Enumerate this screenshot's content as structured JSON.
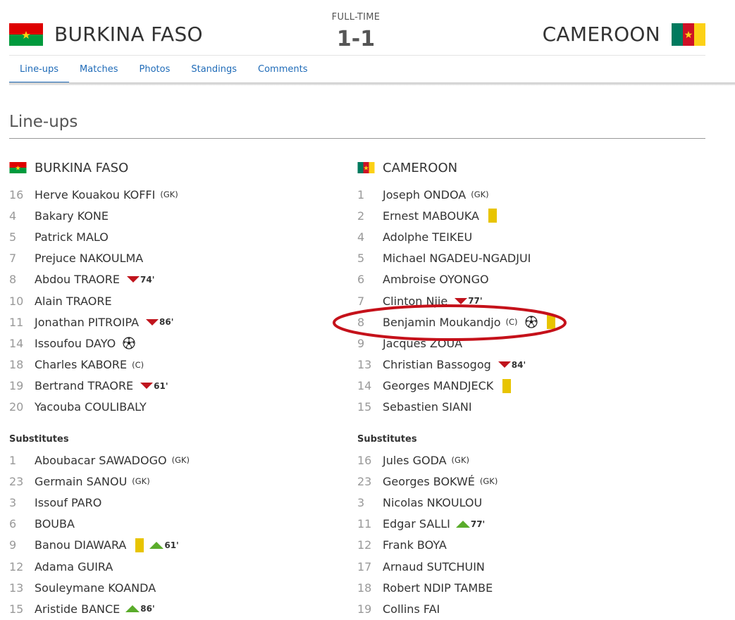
{
  "match": {
    "status": "FULL-TIME",
    "score": "1-1",
    "home_team": "BURKINA FASO",
    "away_team": "CAMEROON"
  },
  "tabs": [
    {
      "label": "Line-ups",
      "active": true
    },
    {
      "label": "Matches",
      "active": false
    },
    {
      "label": "Photos",
      "active": false
    },
    {
      "label": "Standings",
      "active": false
    },
    {
      "label": "Comments",
      "active": false
    }
  ],
  "section_title": "Line-ups",
  "substitutes_label": "Substitutes",
  "colors": {
    "link": "#1f6bb8",
    "sub_off_arrow": "#c0141d",
    "sub_on_arrow": "#5aac2b",
    "yellow_card": "#e8c400",
    "highlight_ring": "#c5111a",
    "flag_bf_red": "#de0000",
    "flag_bf_green": "#009a3d",
    "flag_bf_star": "#fcd116",
    "flag_cm_green": "#007a5e",
    "flag_cm_red": "#ce1126",
    "flag_cm_yellow": "#fcd116"
  },
  "home": {
    "team": "BURKINA FASO",
    "starting": [
      {
        "num": "16",
        "name": "Herve Kouakou KOFFI",
        "tag": "(GK)"
      },
      {
        "num": "4",
        "name": "Bakary KONE"
      },
      {
        "num": "5",
        "name": "Patrick MALO"
      },
      {
        "num": "7",
        "name": "Prejuce NAKOULMA"
      },
      {
        "num": "8",
        "name": "Abdou TRAORE",
        "sub_off": "74'"
      },
      {
        "num": "10",
        "name": "Alain TRAORE"
      },
      {
        "num": "11",
        "name": "Jonathan PITROIPA",
        "sub_off": "86'"
      },
      {
        "num": "14",
        "name": "Issoufou DAYO",
        "goal": true
      },
      {
        "num": "18",
        "name": "Charles KABORE",
        "tag": "(C)"
      },
      {
        "num": "19",
        "name": "Bertrand TRAORE",
        "sub_off": "61'"
      },
      {
        "num": "20",
        "name": "Yacouba COULIBALY"
      }
    ],
    "subs": [
      {
        "num": "1",
        "name": "Aboubacar SAWADOGO",
        "tag": "(GK)"
      },
      {
        "num": "23",
        "name": "Germain SANOU",
        "tag": "(GK)"
      },
      {
        "num": "3",
        "name": "Issouf PARO"
      },
      {
        "num": "6",
        "name": "BOUBA"
      },
      {
        "num": "9",
        "name": "Banou DIAWARA",
        "yellow": true,
        "sub_on": "61'"
      },
      {
        "num": "12",
        "name": "Adama GUIRA"
      },
      {
        "num": "13",
        "name": "Souleymane KOANDA"
      },
      {
        "num": "15",
        "name": "Aristide BANCE",
        "sub_on": "86'"
      }
    ]
  },
  "away": {
    "team": "CAMEROON",
    "starting": [
      {
        "num": "1",
        "name": "Joseph ONDOA",
        "tag": "(GK)"
      },
      {
        "num": "2",
        "name": "Ernest MABOUKA",
        "yellow": true
      },
      {
        "num": "4",
        "name": "Adolphe TEIKEU"
      },
      {
        "num": "5",
        "name": "Michael NGADEU-NGADJUI"
      },
      {
        "num": "6",
        "name": "Ambroise OYONGO"
      },
      {
        "num": "7",
        "name": "Clinton Njie",
        "sub_off": "77'"
      },
      {
        "num": "8",
        "name": "Benjamin Moukandjo",
        "tag": "(C)",
        "goal": true,
        "yellow": true
      },
      {
        "num": "9",
        "name": "Jacques ZOUA"
      },
      {
        "num": "13",
        "name": "Christian Bassogog",
        "sub_off": "84'"
      },
      {
        "num": "14",
        "name": "Georges MANDJECK",
        "yellow": true
      },
      {
        "num": "15",
        "name": "Sebastien SIANI"
      }
    ],
    "subs": [
      {
        "num": "16",
        "name": "Jules GODA",
        "tag": "(GK)"
      },
      {
        "num": "23",
        "name": "Georges BOKWÉ",
        "tag": "(GK)"
      },
      {
        "num": "3",
        "name": "Nicolas NKOULOU"
      },
      {
        "num": "11",
        "name": "Edgar SALLI",
        "sub_on": "77'"
      },
      {
        "num": "12",
        "name": "Frank BOYA"
      },
      {
        "num": "17",
        "name": "Arnaud SUTCHUIN"
      },
      {
        "num": "18",
        "name": "Robert NDIP TAMBE"
      },
      {
        "num": "19",
        "name": "Collins FAI"
      }
    ]
  }
}
